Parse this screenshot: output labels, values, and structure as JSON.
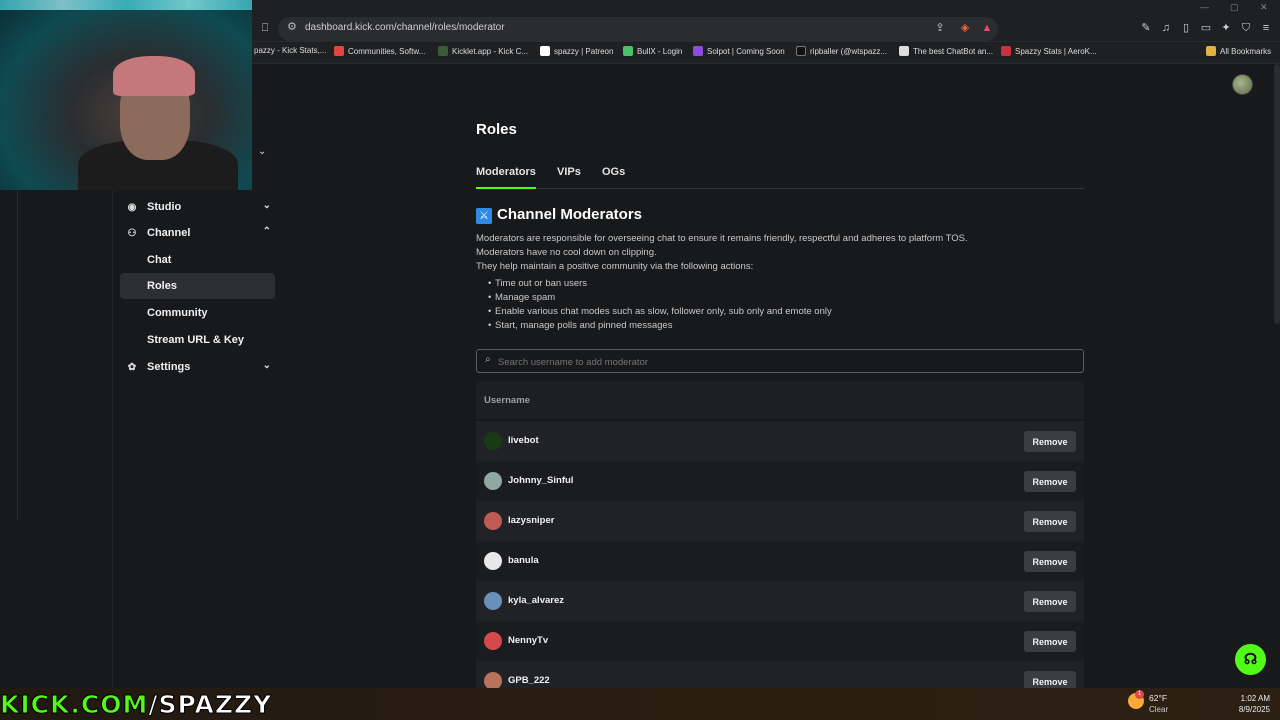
{
  "browser": {
    "url": "dashboard.kick.com/channel/roles/moderator",
    "bookmarks": [
      "pazzy - Kick Stats,...",
      "Communities, Softw...",
      "Kicklet.app - Kick C...",
      "spazzy | Patreon",
      "BullX - Login",
      "Solpot | Coming Soon",
      "ripballer (@wtspazz...",
      "The best ChatBot an...",
      "Spazzy Stats | AeroK..."
    ],
    "all_bookmarks": "All Bookmarks"
  },
  "sidebar": {
    "items": [
      {
        "label": "Studio",
        "icon": "studio-icon"
      },
      {
        "label": "Channel",
        "icon": "channel-icon"
      },
      {
        "label": "Chat"
      },
      {
        "label": "Roles"
      },
      {
        "label": "Community"
      },
      {
        "label": "Stream URL & Key"
      },
      {
        "label": "Settings",
        "icon": "gear-icon"
      }
    ]
  },
  "main": {
    "title": "Roles",
    "tabs": [
      "Moderators",
      "VIPs",
      "OGs"
    ],
    "active_tab": "Moderators",
    "section_title": "Channel Moderators",
    "description": [
      "Moderators are responsible for overseeing chat to ensure it remains friendly, respectful and adheres to platform TOS.",
      "Moderators have no cool down on clipping.",
      "They help maintain a positive community via the following actions:"
    ],
    "actions": [
      "Time out or ban users",
      "Manage spam",
      "Enable various chat modes such as slow, follower only, sub only and emote only",
      "Start, manage polls and pinned messages"
    ],
    "search_placeholder": "Search username to add moderator",
    "table_header": "Username",
    "remove_label": "Remove",
    "moderators": [
      {
        "username": "livebot",
        "avatar_color": "#1a3a14"
      },
      {
        "username": "Johnny_Sinful",
        "avatar_color": "#8fa8a0"
      },
      {
        "username": "lazysniper",
        "avatar_color": "#c05a55"
      },
      {
        "username": "banula",
        "avatar_color": "#e8e8e8"
      },
      {
        "username": "kyla_alvarez",
        "avatar_color": "#6a8fb8"
      },
      {
        "username": "NennyTv",
        "avatar_color": "#d44a4a"
      },
      {
        "username": "GPB_222",
        "avatar_color": "#b8735a"
      }
    ]
  },
  "overlay": {
    "prefix": "KICK.COM",
    "suffix": "/SPAZZY"
  },
  "taskbar": {
    "temperature": "62°F",
    "weather": "Clear",
    "weather_badge": "1",
    "time": "1:02 AM",
    "date": "8/9/2025"
  },
  "colors": {
    "accent": "#53fc18",
    "section_icon": "#2d8be6"
  }
}
